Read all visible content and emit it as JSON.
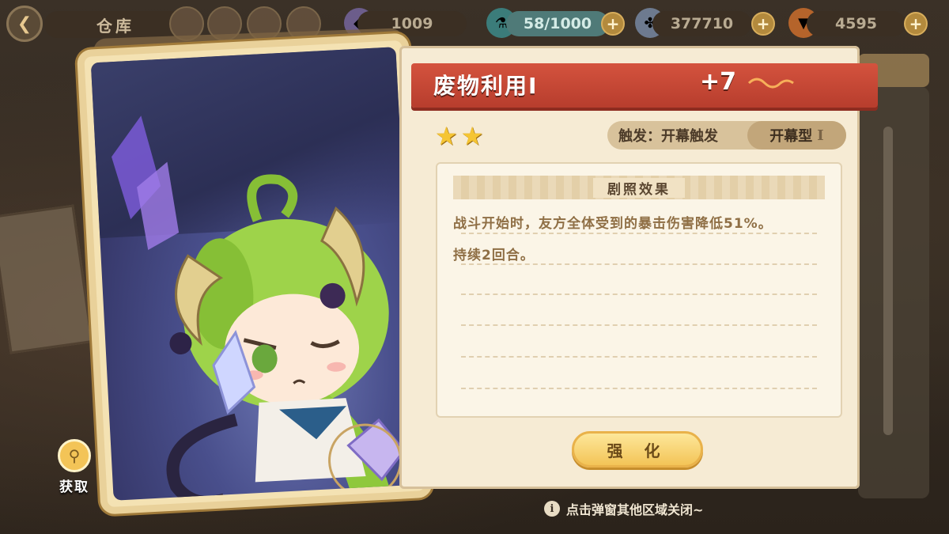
{
  "topbar": {
    "title": "仓库",
    "resources": [
      {
        "icon": "gem-icon",
        "value": "1009"
      },
      {
        "icon": "potion-icon",
        "value": "58/1000"
      },
      {
        "icon": "clover-coin-icon",
        "value": "377710"
      },
      {
        "icon": "carrot-icon",
        "value": "4595"
      }
    ]
  },
  "card": {
    "name": "废物利用Ⅰ",
    "level": "+7",
    "stars": 2,
    "trigger": "触发：开幕触发",
    "type": "开幕型",
    "type_roman": "I"
  },
  "effect": {
    "header": "剧照效果",
    "lines": [
      "战斗开始时，友方全体受到的暴击伤害降低51%。",
      "持续2回合。"
    ]
  },
  "actions": {
    "enhance": "强 化",
    "obtain": "获取"
  },
  "hint": "点击弹窗其他区域关闭~",
  "colors": {
    "ribbon": "#c8473a",
    "panel": "#f6ebd4",
    "button": "#f3c457",
    "star": "#f5c533"
  }
}
